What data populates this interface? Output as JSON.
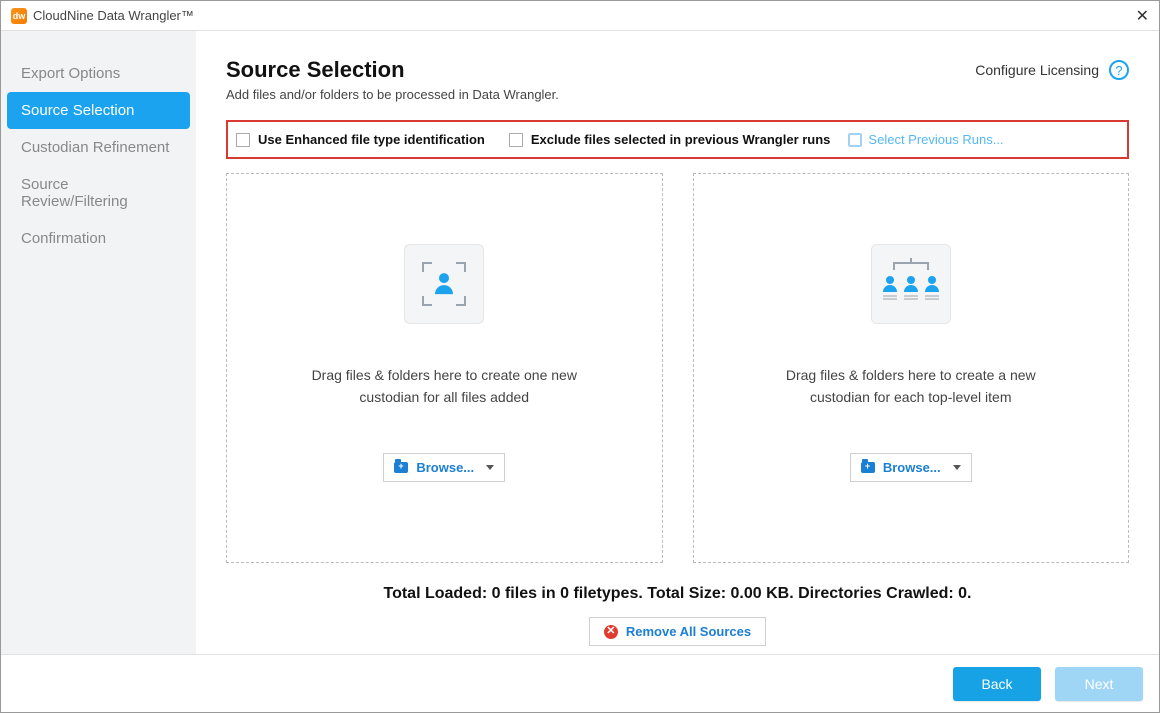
{
  "window": {
    "title": "CloudNine Data Wrangler™"
  },
  "nav": {
    "items": [
      {
        "label": "Export Options"
      },
      {
        "label": "Source Selection"
      },
      {
        "label": "Custodian Refinement"
      },
      {
        "label": "Source Review/Filtering"
      },
      {
        "label": "Confirmation"
      }
    ],
    "active_index": 1
  },
  "header": {
    "title": "Source Selection",
    "subtitle": "Add files and/or folders to be processed in Data Wrangler.",
    "configure": "Configure Licensing",
    "help": "?"
  },
  "options": {
    "enhanced": "Use Enhanced file type identification",
    "exclude": "Exclude files selected in previous Wrangler runs",
    "select_prev": "Select Previous Runs..."
  },
  "dropzones": {
    "single": {
      "line1": "Drag files & folders here to create one new",
      "line2": "custodian for all files added",
      "browse": "Browse..."
    },
    "multi": {
      "line1": "Drag files & folders here to create a new",
      "line2": "custodian for each top-level item",
      "browse": "Browse..."
    }
  },
  "totals": {
    "text": "Total Loaded: 0 files in 0 filetypes. Total Size: 0.00 KB. Directories Crawled: 0.",
    "files": 0,
    "filetypes": 0,
    "size": "0.00 KB",
    "directories": 0
  },
  "remove": "Remove All Sources",
  "footer": {
    "back": "Back",
    "next": "Next"
  },
  "colors": {
    "accent": "#1ba3f0",
    "highlight_box": "#d83a32"
  }
}
